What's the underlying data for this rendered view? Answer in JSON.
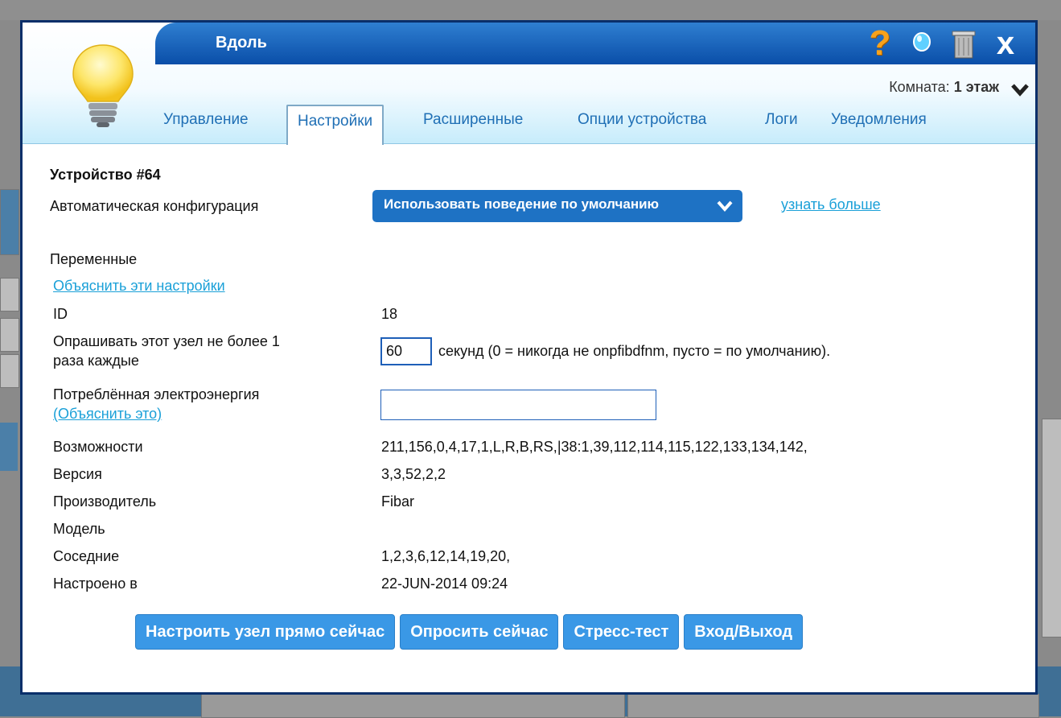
{
  "dialog": {
    "title": "Вдоль",
    "room_label": "Комната:",
    "room_value": "1 этаж"
  },
  "icons": {
    "help": "?",
    "close": "x"
  },
  "tabs": [
    {
      "label": "Управление",
      "active": false
    },
    {
      "label": "Настройки",
      "active": true
    },
    {
      "label": "Расширенные",
      "active": false
    },
    {
      "label": "Опции устройства",
      "active": false
    },
    {
      "label": "Логи",
      "active": false
    },
    {
      "label": "Уведомления",
      "active": false
    }
  ],
  "settings": {
    "device_title": "Устройство #64",
    "auto_config_label": "Автоматическая конфигурация",
    "auto_config_value": "Использовать поведение по умолчанию",
    "learn_more": "узнать больше",
    "variables_label": "Переменные",
    "explain_settings": "Объяснить эти настройки",
    "id_label": "ID",
    "id_value": "18",
    "poll_label_line1": "Опрашивать этот узел не более 1",
    "poll_label_line2": "раза каждые",
    "poll_value": "60",
    "poll_hint": "секунд (0 = никогда не onpfibdfnm, пусто = по умолчанию).",
    "energy_label": "Потреблённая электроэнергия",
    "energy_explain": "(Объяснить это)",
    "energy_value": "",
    "capabilities_label": "Возможности",
    "capabilities_value": "211,156,0,4,17,1,L,R,B,RS,|38:1,39,112,114,115,122,133,134,142,",
    "version_label": "Версия",
    "version_value": "3,3,52,2,2",
    "manufacturer_label": "Производитель",
    "manufacturer_value": "Fibar",
    "model_label": "Модель",
    "model_value": "",
    "neighbors_label": "Соседние",
    "neighbors_value": "1,2,3,6,12,14,19,20,",
    "configured_label": "Настроено в",
    "configured_value": "22-JUN-2014 09:24"
  },
  "actions": [
    "Настроить узел прямо сейчас",
    "Опросить сейчас",
    "Стресс-тест",
    "Вход/Выход"
  ],
  "colors": {
    "accent": "#1e72c4",
    "link": "#1aa0d8",
    "title_bar": "#0a4ea8",
    "button": "#3a98e6"
  }
}
